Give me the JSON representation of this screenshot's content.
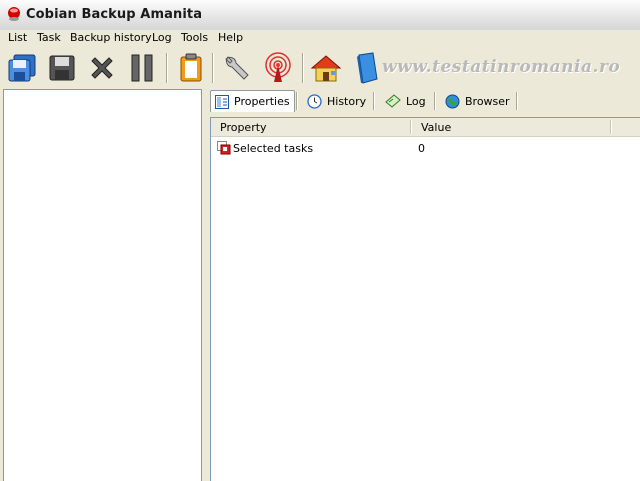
{
  "window": {
    "title": "Cobian Backup Amanita"
  },
  "menu": [
    "List",
    "Task",
    "Backup history",
    "Log",
    "Tools",
    "Help"
  ],
  "watermark": "www.testatinromania.ro",
  "toolbar": {
    "buttons": [
      {
        "name": "backup-selected-button",
        "icon": "floppy-disks-icon"
      },
      {
        "name": "save-list-button",
        "icon": "floppy-disk-icon"
      },
      {
        "name": "stop-button",
        "icon": "close-x-icon"
      },
      {
        "name": "pause-button",
        "icon": "pause-icon"
      },
      {
        "name": "clipboard-button",
        "icon": "clipboard-icon"
      },
      {
        "name": "options-button",
        "icon": "wrench-icon"
      },
      {
        "name": "service-button",
        "icon": "antenna-icon"
      },
      {
        "name": "homepage-button",
        "icon": "home-icon"
      },
      {
        "name": "help-button",
        "icon": "book-icon"
      }
    ]
  },
  "tabs": [
    {
      "label": "Properties",
      "active": true,
      "icon": "properties-icon"
    },
    {
      "label": "History",
      "active": false,
      "icon": "clock-icon"
    },
    {
      "label": "Log",
      "active": false,
      "icon": "log-icon"
    },
    {
      "label": "Browser",
      "active": false,
      "icon": "globe-icon"
    }
  ],
  "table": {
    "columns": [
      "Property",
      "Value"
    ],
    "rows": [
      {
        "property": "Selected tasks",
        "value": "0",
        "icon": "tasks-icon"
      }
    ]
  }
}
